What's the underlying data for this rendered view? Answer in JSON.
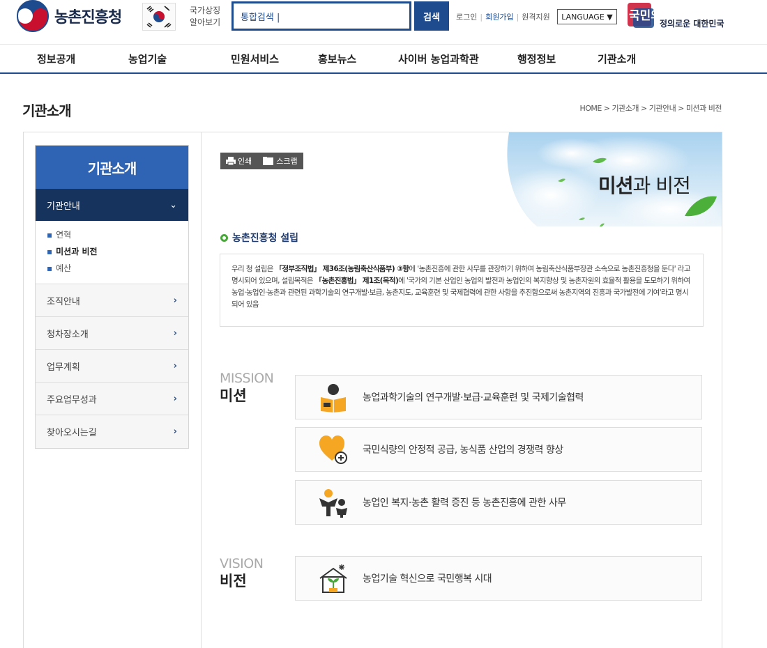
{
  "header": {
    "logo_text": "농촌진흥청",
    "national_symbol": [
      "국가상징",
      "알아보기"
    ],
    "search_value": "통합검색 |",
    "search_button": "검색",
    "util_login": "로그인",
    "util_join": "회원가입",
    "util_remote": "원격지원",
    "language_button": "LANGUAGE ▼",
    "slogan_line1": "국민의 나라",
    "slogan_line2": "정의로운 대한민국"
  },
  "gnb": [
    "정보공개",
    "농업기술",
    "민원서비스",
    "홍보뉴스",
    "사이버 농업과학관",
    "행정정보",
    "기관소개"
  ],
  "page": {
    "title": "기관소개",
    "breadcrumb": "HOME > 기관소개 > 기관안내 > 미션과 비전"
  },
  "lnb": {
    "title": "기관소개",
    "active": "기관안내",
    "active_arrow": "⌄",
    "sub_items": [
      "연혁",
      "미션과 비전",
      "예산"
    ],
    "items": [
      "조직안내",
      "청차장소개",
      "업무계획",
      "주요업무성과",
      "찾아오시는길"
    ],
    "arrow": "›"
  },
  "tools": {
    "print": "인쇄",
    "scrap": "스크랩"
  },
  "hero": {
    "title_bold": "미션",
    "title_rest": "과 비전"
  },
  "section": {
    "title": "농촌진흥청 설립",
    "intro_p1": "우리 청 설립은 ",
    "intro_b1": "「정부조직법」 제36조(농림축산식품부) ③항",
    "intro_p2": "에 '농촌진흥에 관한 사무를 관장하기 위하여 농림축산식품부장관 소속으로 농촌진흥청을 둔다' 라고 명시되어 있으며, 설립목적은 ",
    "intro_b2": "「농촌진흥법」 제1조(목적)",
    "intro_p3": "에 '국가의 기본 산업인 농업의 발전과 농업인의 복지향상 및 농촌자원의 효율적 활용을 도모하기 위하여 농업·농업인·농촌과 관련된 과학기술의 연구개발·보급, 농촌지도, 교육훈련 및 국제협력에 관한 사항을 추진함으로써 농촌지역의 진흥과 국가발전에 기여'라고 명시되어 있음"
  },
  "mission": {
    "label_en": "MISSION",
    "label_ko": "미션",
    "items": [
      {
        "icon": "book-reader-icon",
        "text": "농업과학기술의 연구개발·보급·교육훈련 및 국제기술협력"
      },
      {
        "icon": "heart-plus-icon",
        "text": "국민식량의 안정적 공급, 농식품 산업의 경쟁력 향상"
      },
      {
        "icon": "people-sprout-icon",
        "text": "농업인 복지·농촌 활력 증진 등 농촌진흥에 관한 사무"
      }
    ]
  },
  "vision": {
    "label_en": "VISION",
    "label_ko": "비전",
    "text": "농업기술 혁신으로 국민행복 시대",
    "icon": "house-sprout-icon"
  },
  "colors": {
    "primary": "#1e4b8e",
    "lnb_head": "#2e64b3",
    "lnb_active": "#16335e",
    "accent_green": "#4aa73c",
    "icon_orange": "#f5a623"
  }
}
